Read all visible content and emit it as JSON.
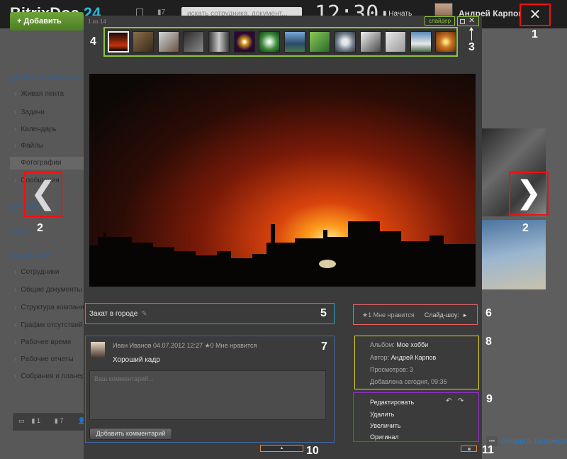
{
  "topbar": {
    "logo_text": "BitrixDoc",
    "logo_num": "24",
    "search_placeholder": "искать сотрудника, документ...",
    "clock": "12:30",
    "start_label": "Начать",
    "user_name": "Андрей Карпов"
  },
  "sidebar": {
    "add_button": "Добавить",
    "section_tools": "МОИ ИНСТРУМЕНТЫ",
    "items_tools": [
      "Живая лента",
      "Задачи",
      "Календарь",
      "Файлы",
      "Фотографии",
      "Сообщения"
    ],
    "section_groups": "ГРУППЫ",
    "section_crm": "CRM",
    "section_company": "КОМПАНИЯ",
    "items_company": [
      "Сотрудники",
      "Общие документы",
      "Структура компании",
      "График отсутствий",
      "Рабочее время",
      "Рабочие отчеты",
      "Собрания и планерки"
    ],
    "bottom_counts": [
      "1",
      "7"
    ]
  },
  "viewer": {
    "counter": "1 из 14",
    "slider_label": "слайдер",
    "close_glyph": "✕",
    "photo_title": "Закат в городе",
    "like_text": "★1 Мне нравится",
    "slideshow_label": "Слайд-шоу:",
    "comment": {
      "author_line": "Иван Иванов   04.07.2012 12:27   ★0 Мне нравится",
      "text": "Хороший кадр",
      "input_placeholder": "Ваш комментарий...",
      "submit_label": "Добавить комментарий"
    },
    "info": {
      "album_label": "Альбом:",
      "album_value": "Мое хобби",
      "author_label": "Автор:",
      "author_value": "Андрей Карпов",
      "views_label": "Просмотров:",
      "views_value": "3",
      "added": "Добавлена сегодня, 09:36"
    },
    "actions": [
      "Редактировать",
      "Удалить",
      "Увеличить",
      "Оригинал"
    ],
    "rotate_left": "↶",
    "rotate_right": "↷"
  },
  "overlay": {
    "prev_glyph": "❮",
    "next_glyph": "❯",
    "close_glyph": "✕"
  },
  "footer": {
    "discuss_link": "Обсудить Битрикс24"
  },
  "callouts": [
    "1",
    "2",
    "2",
    "3",
    "4",
    "5",
    "6",
    "7",
    "8",
    "9",
    "10",
    "11"
  ],
  "colors": {
    "callout_red": "#e11111",
    "strip_green": "#8bc53f",
    "title_cyan": "#27a6c8",
    "like_pink": "#e46464",
    "comment_blue": "#3f67a8",
    "info_yellow": "#e0d230",
    "actions_purple": "#9b2bd0",
    "bottom_orange": "#f0883a"
  },
  "thumbnails": [
    "sunset",
    "street",
    "snow-trees",
    "city",
    "buildings",
    "lights",
    "flower",
    "lake",
    "leaves",
    "glass-globe",
    "winter",
    "bicycle",
    "waterfall",
    "candle"
  ]
}
